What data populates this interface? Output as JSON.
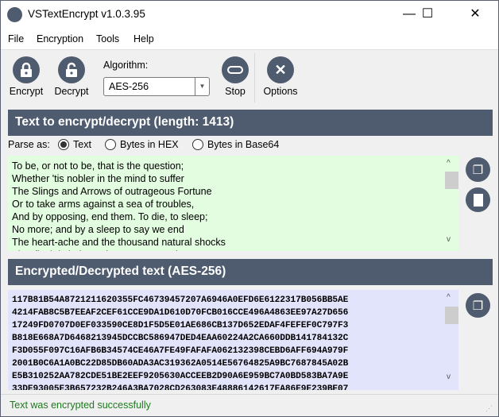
{
  "window": {
    "title": "VSTextEncrypt v1.0.3.95",
    "minimize": "—",
    "maximize": "☐",
    "close": "✕"
  },
  "menu": [
    "File",
    "Encryption",
    "Tools",
    "Help"
  ],
  "toolbar": {
    "encrypt": "Encrypt",
    "decrypt": "Decrypt",
    "algorithm_label": "Algorithm:",
    "algorithm_value": "AES-256",
    "stop": "Stop",
    "options": "Options"
  },
  "input_section": {
    "title": "Text to encrypt/decrypt (length: 1413)",
    "parse_label": "Parse as:",
    "options": [
      "Text",
      "Bytes in HEX",
      "Bytes in Base64"
    ],
    "selected": "Text",
    "text": "To be, or not to be, that is the question;\nWhether 'tis nobler in the mind to suffer\nThe Slings and Arrows of outrageous Fortune\nOr to take arms against a sea of troubles,\nAnd by opposing, end them. To die, to sleep;\nNo more; and by a sleep to say we end\nThe heart-ache and the thousand natural shocks\nThat flesh is heir to: 'tis a consummation"
  },
  "output_section": {
    "title": "Encrypted/Decrypted text (AES-256)",
    "text": "117B81B54A8721211620355FC46739457207A6946A0EFD6E6122317B056BB5AE\n4214FAB8C5B7EEAF2CEF61CCE9DA1D610D70FCB016CCE496A4863EE97A27D656\n17249FD0707D0EF033590CE8D1F5D5E01AE686CB137D652EDAF4FEFEF0C797F3\nB818E668A7D6468213945DCCBC586947DED4EAA60224A2CA660DDB141784132C\nF3D055F097C16AFB6B34574CE46A7FE49FAFAFA062132398CEBD6AFF694A979F\n2001B0C6A1A0BC22D85DB60ADA3AC319362A0514E56764825A9BC7687845A02B\nE5B310252AA782CDE51BE2EEF9205630ACCEEB2D90A6E959BC7A0BD583BA7A9E\n33DE93005E3B657232B246A3BA7028CD263083E48886142617EA86E9E239BE07"
  },
  "status": "Text was encrypted successfully",
  "colors": {
    "header": "#4f5b6e",
    "input_bg": "#e3fde0",
    "output_bg": "#e2e4fc",
    "status": "#1e7a1e"
  }
}
